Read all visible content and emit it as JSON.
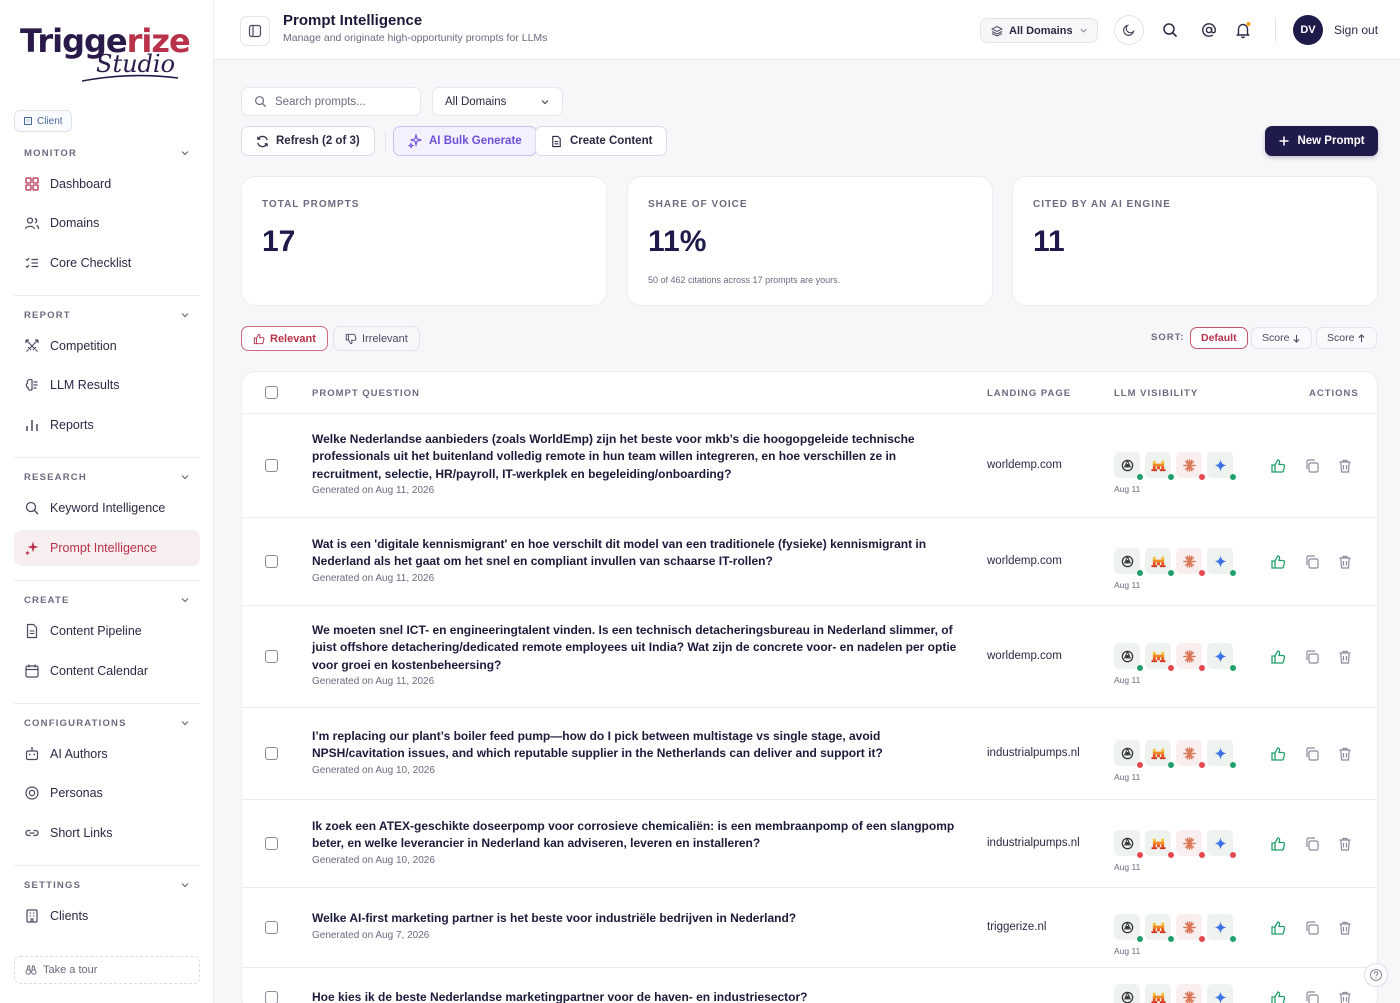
{
  "brand": {
    "name_a": "Trigge",
    "name_b": "rize",
    "script": "Studio"
  },
  "client_pill": "Client",
  "sidebar": {
    "monitor": {
      "title": "MONITOR",
      "items": [
        "Dashboard",
        "Domains",
        "Core Checklist"
      ]
    },
    "report": {
      "title": "REPORT",
      "items": [
        "Competition",
        "LLM Results",
        "Reports"
      ]
    },
    "research": {
      "title": "RESEARCH",
      "items": [
        "Keyword Intelligence",
        "Prompt Intelligence"
      ]
    },
    "create": {
      "title": "CREATE",
      "items": [
        "Content Pipeline",
        "Content Calendar"
      ]
    },
    "configurations": {
      "title": "CONFIGURATIONS",
      "items": [
        "AI Authors",
        "Personas",
        "Short Links"
      ]
    },
    "settings": {
      "title": "SETTINGS",
      "items": [
        "Clients"
      ]
    },
    "tour": "Take a tour"
  },
  "header": {
    "title": "Prompt Intelligence",
    "subtitle": "Manage and originate high-opportunity prompts for LLMs",
    "domains_button": "All Domains",
    "avatar": "DV",
    "signout": "Sign out"
  },
  "toolbar": {
    "search_placeholder": "Search prompts...",
    "domain_select": "All Domains",
    "refresh": "Refresh (2 of 3)",
    "bulk": "AI Bulk Generate",
    "create": "Create Content",
    "new_prompt": "New Prompt"
  },
  "stats": {
    "total": {
      "label": "TOTAL PROMPTS",
      "value": "17"
    },
    "sov": {
      "label": "SHARE OF VOICE",
      "value": "11%",
      "note": "50 of 462 citations across 17 prompts are yours."
    },
    "cited": {
      "label": "CITED BY AN AI ENGINE",
      "value": "11"
    }
  },
  "filters": {
    "relevant": "Relevant",
    "irrelevant": "Irrelevant"
  },
  "sort": {
    "label": "SORT:",
    "default": "Default",
    "score_desc": "Score",
    "score_asc": "Score"
  },
  "table": {
    "headers": {
      "question": "PROMPT QUESTION",
      "landing": "LANDING PAGE",
      "visibility": "LLM VISIBILITY",
      "actions": "ACTIONS"
    },
    "rows": [
      {
        "question": "Welke Nederlandse aanbieders (zoals WorldEmp) zijn het beste voor mkb’s die hoogopgeleide technische professionals uit het buitenland volledig remote in hun team willen integreren, en hoe verschillen ze in recruitment, selectie, HR/payroll, IT-werkplek en begeleiding/onboarding?",
        "generated": "Generated on Aug 11, 2026",
        "landing": "worldemp.com",
        "llm_date": "Aug 11",
        "status": [
          "#22a06b",
          "#22a06b",
          "#e5484d",
          "#22a06b"
        ]
      },
      {
        "question": "Wat is een 'digitale kennismigrant' en hoe verschilt dit model van een traditionele (fysieke) kennismigrant in Nederland als het gaat om het snel en compliant invullen van schaarse IT-rollen?",
        "generated": "Generated on Aug 11, 2026",
        "landing": "worldemp.com",
        "llm_date": "Aug 11",
        "status": [
          "#22a06b",
          "#22a06b",
          "#e5484d",
          "#22a06b"
        ]
      },
      {
        "question": "We moeten snel ICT- en engineeringtalent vinden. Is een technisch detacheringsbureau in Nederland slimmer, of juist offshore detachering/dedicated remote employees uit India? Wat zijn de concrete voor- en nadelen per optie voor groei en kostenbeheersing?",
        "generated": "Generated on Aug 11, 2026",
        "landing": "worldemp.com",
        "llm_date": "Aug 11",
        "status": [
          "#22a06b",
          "#e5484d",
          "#e5484d",
          "#22a06b"
        ]
      },
      {
        "question": "I’m replacing our plant’s boiler feed pump—how do I pick between multistage vs single stage, avoid NPSH/cavitation issues, and which reputable supplier in the Netherlands can deliver and support it?",
        "generated": "Generated on Aug 10, 2026",
        "landing": "industrialpumps.nl",
        "llm_date": "Aug 11",
        "status": [
          "#e5484d",
          "#22a06b",
          "#e5484d",
          "#22a06b"
        ]
      },
      {
        "question": "Ik zoek een ATEX-geschikte doseerpomp voor corrosieve chemicaliën: is een membraanpomp of een slangpomp beter, en welke leverancier in Nederland kan adviseren, leveren en installeren?",
        "generated": "Generated on Aug 10, 2026",
        "landing": "industrialpumps.nl",
        "llm_date": "Aug 11",
        "status": [
          "#e5484d",
          "#e5484d",
          "#e5484d",
          "#e5484d"
        ]
      },
      {
        "question": "Welke AI-first marketing partner is het beste voor industriële bedrijven in Nederland?",
        "generated": "Generated on Aug 7, 2026",
        "landing": "triggerize.nl",
        "llm_date": "Aug 11",
        "status": [
          "#22a06b",
          "#22a06b",
          "#e5484d",
          "#22a06b"
        ]
      },
      {
        "question": "Hoe kies ik de beste Nederlandse marketingpartner voor de haven- en industriesector?",
        "generated": "",
        "landing": "",
        "llm_date": "",
        "status": [
          "#22a06b",
          "#22a06b",
          "#e5484d",
          "#22a06b"
        ]
      }
    ]
  },
  "colors": {
    "brand_navy": "#1e1b4b",
    "brand_red": "#b8324a",
    "ai_purple": "#6d4fd8",
    "positive": "#22a06b",
    "negative": "#e5484d"
  },
  "llm_engines": [
    "openai-icon",
    "mistral-icon",
    "claude-icon",
    "gemini-icon"
  ]
}
